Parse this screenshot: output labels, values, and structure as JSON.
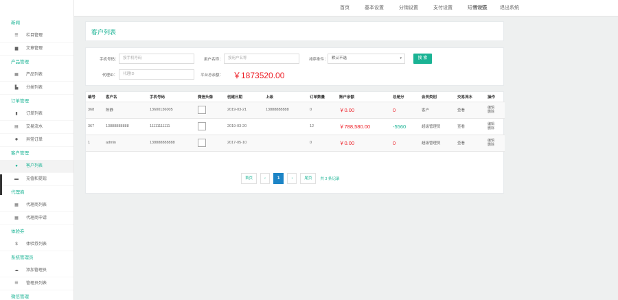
{
  "topnav": [
    "首页",
    "基本设置",
    "分销设置",
    "支付设置",
    "短信设置"
  ],
  "topnav_right": [
    "管理员",
    "退出系统"
  ],
  "sidebar": [
    {
      "title": "新闻",
      "items": [
        {
          "label": "栏目管理",
          "icon": "list-icon"
        },
        {
          "label": "文章管理",
          "icon": "document-icon"
        }
      ]
    },
    {
      "title": "产品管理",
      "items": [
        {
          "label": "产品列表",
          "icon": "grid-icon"
        },
        {
          "label": "分类列表",
          "icon": "bars-icon"
        }
      ]
    },
    {
      "title": "订单管理",
      "items": [
        {
          "label": "订单列表",
          "icon": "bookmark-icon"
        },
        {
          "label": "交易流水",
          "icon": "list-box-icon"
        },
        {
          "label": "异常订单",
          "icon": "gear-icon"
        }
      ]
    },
    {
      "title": "客户管理",
      "items": [
        {
          "label": "客户列表",
          "icon": "user-icon",
          "active": true
        },
        {
          "label": "充值和提现",
          "icon": "wallet-icon"
        }
      ]
    },
    {
      "title": "代理商",
      "items": [
        {
          "label": "代理商列表",
          "icon": "grid-icon"
        },
        {
          "label": "代理商申请",
          "icon": "grid-icon"
        }
      ]
    },
    {
      "title": "体验券",
      "items": [
        {
          "label": "体验券列表",
          "icon": "dollar-icon"
        }
      ]
    },
    {
      "title": "系统管理员",
      "items": [
        {
          "label": "添加管理员",
          "icon": "cloud-icon"
        },
        {
          "label": "管理员列表",
          "icon": "list-icon"
        }
      ]
    },
    {
      "title": "微信管理",
      "items": []
    }
  ],
  "page_title": "客户列表",
  "search": {
    "phone_label": "手机号码：",
    "phone_placeholder": "按手机号码",
    "username_label": "用户名称：",
    "username_placeholder": "按用户名称",
    "sort_label": "排序条件：",
    "sort_value": "默认不选",
    "search_button": "搜 索",
    "agent_label": "代理ID：",
    "agent_placeholder": "代理ID",
    "total_label": "平台总余额：",
    "total_value": "￥1873520.00"
  },
  "table": {
    "columns": [
      "编号",
      "客户名",
      "手机号码",
      "微信头像",
      "创建日期",
      "上级",
      "订单数量",
      "账户余额",
      "总是分",
      "会员类别",
      "交易流水",
      "操作"
    ],
    "rows": [
      {
        "id": "368",
        "name": "陈静",
        "phone": "13600136005",
        "created": "2019-03-21",
        "parent": "13888888888",
        "orders": "0",
        "balance": "￥0.00",
        "points": "0",
        "member": "客户",
        "flow": "查看",
        "ops": [
          "编辑",
          "删除"
        ]
      },
      {
        "id": "367",
        "name": "13888888888",
        "phone": "11111111111",
        "created": "2019-03-20",
        "parent": "",
        "orders": "12",
        "balance": "￥788,580.00",
        "points": "-5560",
        "member": "超级管理员",
        "flow": "查看",
        "ops": [
          "编辑",
          "删除"
        ]
      },
      {
        "id": "1",
        "name": "admin",
        "phone": "138888888888",
        "created": "2017-05-10",
        "parent": "",
        "orders": "0",
        "balance": "￥0.00",
        "points": "0",
        "member": "超级管理员",
        "flow": "查看",
        "ops": [
          "编辑",
          "删除"
        ]
      }
    ]
  },
  "pagination": {
    "first": "首页",
    "prev": "‹",
    "current": "1",
    "next": "›",
    "last": "尾页",
    "info": "共 3 条记录"
  },
  "colors": {
    "accent": "#1ab394",
    "money": "#ed1c24",
    "page_active": "#1c84c6"
  }
}
